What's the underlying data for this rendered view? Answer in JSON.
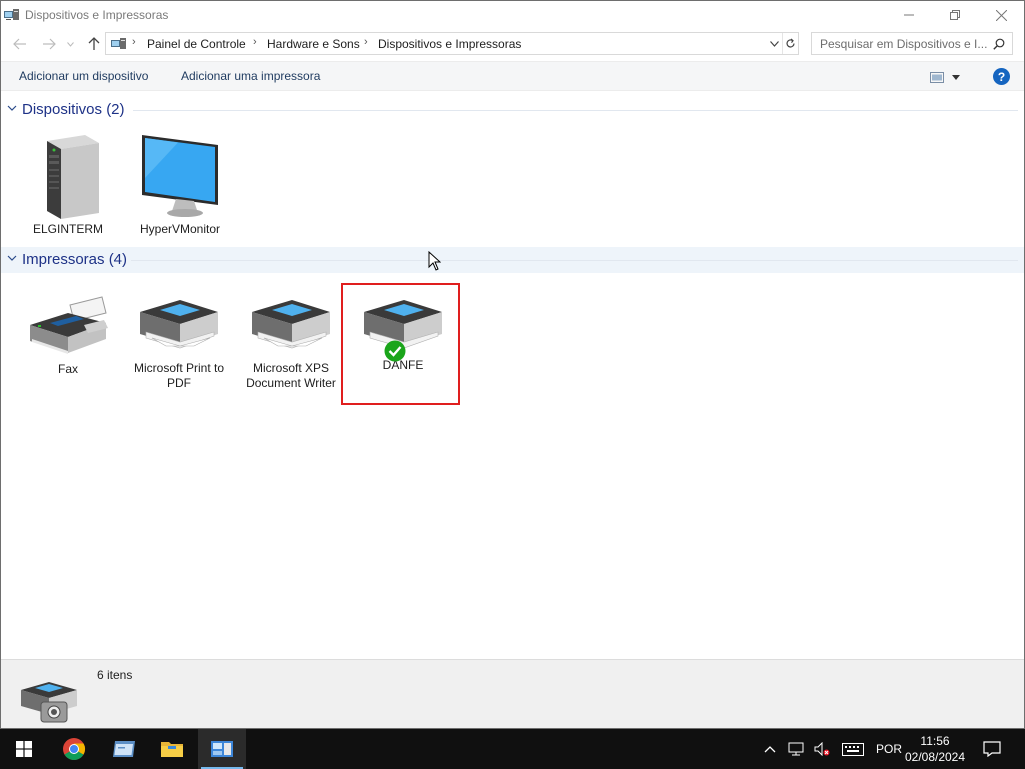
{
  "window": {
    "title": "Dispositivos e Impressoras"
  },
  "address_bar": {
    "breadcrumbs": [
      "Painel de Controle",
      "Hardware e Sons",
      "Dispositivos e Impressoras"
    ]
  },
  "search": {
    "placeholder": "Pesquisar em Dispositivos e I..."
  },
  "command_bar": {
    "add_device": "Adicionar um dispositivo",
    "add_printer": "Adicionar uma impressora",
    "help": "?"
  },
  "groups": {
    "devices": {
      "title": "Dispositivos (2)",
      "items": [
        {
          "label": "ELGINTERM",
          "icon": "computer-tower-icon"
        },
        {
          "label": "HyperVMonitor",
          "icon": "monitor-icon"
        }
      ]
    },
    "printers": {
      "title": "Impressoras (4)",
      "items": [
        {
          "label": "Fax",
          "icon": "fax-icon"
        },
        {
          "label": "Microsoft Print to PDF",
          "icon": "printer-icon"
        },
        {
          "label": "Microsoft XPS Document Writer",
          "icon": "printer-icon"
        },
        {
          "label": "DANFE",
          "icon": "printer-icon",
          "default": true
        }
      ]
    }
  },
  "status": {
    "count": "6 itens"
  },
  "taskbar": {
    "language": "POR",
    "time": "11:56",
    "date": "02/08/2024"
  },
  "colors": {
    "group_title": "#1e3287",
    "selection_border": "#e01e1e",
    "default_check": "#1aa51a",
    "help_icon": "#1565c0",
    "taskbar": "#101010"
  }
}
